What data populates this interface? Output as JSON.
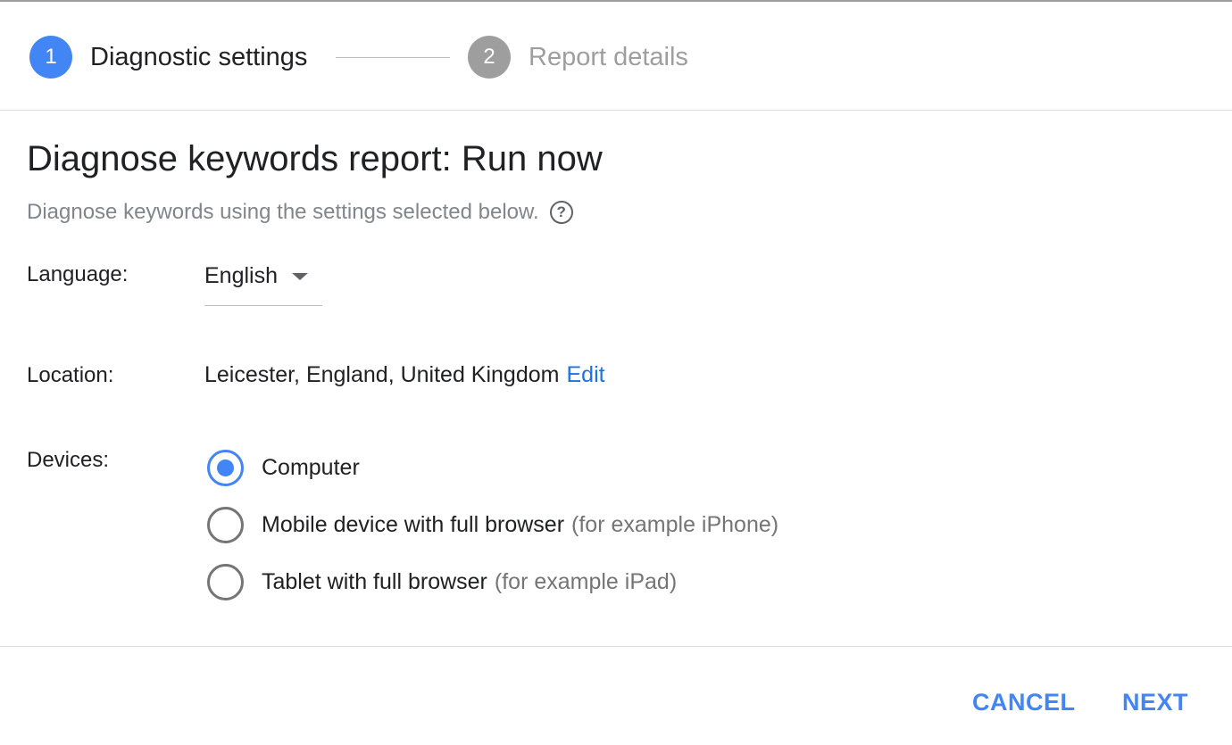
{
  "stepper": {
    "steps": [
      {
        "number": "1",
        "label": "Diagnostic settings",
        "state": "active"
      },
      {
        "number": "2",
        "label": "Report details",
        "state": "inactive"
      }
    ]
  },
  "header": {
    "title": "Diagnose keywords report: Run now",
    "subtitle": "Diagnose keywords using the settings selected below.",
    "help_icon": "?"
  },
  "form": {
    "language": {
      "label": "Language:",
      "value": "English"
    },
    "location": {
      "label": "Location:",
      "value": "Leicester, England, United Kingdom",
      "edit_label": "Edit"
    },
    "devices": {
      "label": "Devices:",
      "options": [
        {
          "label": "Computer",
          "hint": "",
          "checked": true
        },
        {
          "label": "Mobile device with full browser",
          "hint": "(for example iPhone)",
          "checked": false
        },
        {
          "label": "Tablet with full browser",
          "hint": "(for example iPad)",
          "checked": false
        }
      ]
    }
  },
  "footer": {
    "cancel_label": "CANCEL",
    "next_label": "NEXT"
  },
  "colors": {
    "accent": "#4285f4",
    "link": "#1a73e8",
    "inactive": "#9e9e9e"
  }
}
